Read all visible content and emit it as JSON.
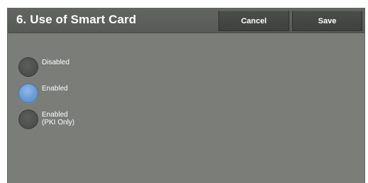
{
  "header": {
    "title": "6. Use of Smart Card",
    "cancel_label": "Cancel",
    "save_label": "Save"
  },
  "options": [
    {
      "label": "Disabled",
      "label_line2": "",
      "selected": false
    },
    {
      "label": "Enabled",
      "label_line2": "",
      "selected": true
    },
    {
      "label": "Enabled",
      "label_line2": "(PKI Only)",
      "selected": false
    }
  ],
  "colors": {
    "panel_bg": "#7b7d79",
    "header_bg": "#5e605d",
    "button_bg": "#454745",
    "radio_selected": "#6a9ad6",
    "radio_unselected": "#4b4d4a",
    "text": "#ffffff"
  }
}
